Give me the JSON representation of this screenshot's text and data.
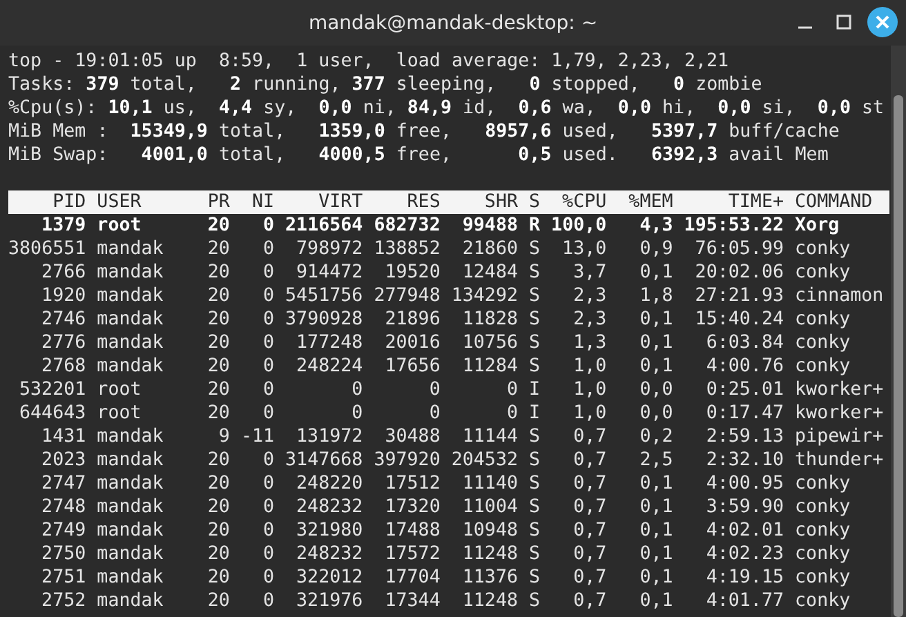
{
  "window": {
    "title": "mandak@mandak-desktop: ~"
  },
  "summary": [
    "top - 19:01:05 up  8:59,  1 user,  load average: 1,79, 2,23, 2,21",
    "Tasks: **379** total,   **2** running, **377** sleeping,   **0** stopped,   **0** zombie",
    "%Cpu(s): **10,1** us,  **4,4** sy,  **0,0** ni, **84,9** id,  **0,6** wa,  **0,0** hi,  **0,0** si,  **0,0** st",
    "MiB Mem :  **15349,9** total,   **1359,0** free,   **8957,6** used,   **5397,7** buff/cache",
    "MiB Swap:   **4001,0** total,   **4000,5** free,      **0,5** used.   **6392,3** avail Mem"
  ],
  "columns": [
    "PID",
    "USER",
    "PR",
    "NI",
    "VIRT",
    "RES",
    "SHR",
    "S",
    "%CPU",
    "%MEM",
    "TIME+",
    "COMMAND"
  ],
  "processes": [
    {
      "cells": [
        "1379",
        "root",
        "20",
        "0",
        "2116564",
        "682732",
        "99488",
        "R",
        "100,0",
        "4,3",
        "195:53.22",
        "Xorg"
      ],
      "highlighted": true
    },
    {
      "cells": [
        "3806551",
        "mandak",
        "20",
        "0",
        "798972",
        "138852",
        "21860",
        "S",
        "13,0",
        "0,9",
        "76:05.99",
        "conky"
      ],
      "highlighted": false
    },
    {
      "cells": [
        "2766",
        "mandak",
        "20",
        "0",
        "914472",
        "19520",
        "12484",
        "S",
        "3,7",
        "0,1",
        "20:02.06",
        "conky"
      ],
      "highlighted": false
    },
    {
      "cells": [
        "1920",
        "mandak",
        "20",
        "0",
        "5451756",
        "277948",
        "134292",
        "S",
        "2,3",
        "1,8",
        "27:21.93",
        "cinnamon"
      ],
      "highlighted": false
    },
    {
      "cells": [
        "2746",
        "mandak",
        "20",
        "0",
        "3790928",
        "21896",
        "11828",
        "S",
        "2,3",
        "0,1",
        "15:40.24",
        "conky"
      ],
      "highlighted": false
    },
    {
      "cells": [
        "2776",
        "mandak",
        "20",
        "0",
        "177248",
        "20016",
        "10756",
        "S",
        "1,3",
        "0,1",
        "6:03.84",
        "conky"
      ],
      "highlighted": false
    },
    {
      "cells": [
        "2768",
        "mandak",
        "20",
        "0",
        "248224",
        "17656",
        "11284",
        "S",
        "1,0",
        "0,1",
        "4:00.76",
        "conky"
      ],
      "highlighted": false
    },
    {
      "cells": [
        "532201",
        "root",
        "20",
        "0",
        "0",
        "0",
        "0",
        "I",
        "1,0",
        "0,0",
        "0:25.01",
        "kworker+"
      ],
      "highlighted": false
    },
    {
      "cells": [
        "644643",
        "root",
        "20",
        "0",
        "0",
        "0",
        "0",
        "I",
        "1,0",
        "0,0",
        "0:17.47",
        "kworker+"
      ],
      "highlighted": false
    },
    {
      "cells": [
        "1431",
        "mandak",
        "9",
        "-11",
        "131972",
        "30488",
        "11144",
        "S",
        "0,7",
        "0,2",
        "2:59.13",
        "pipewir+"
      ],
      "highlighted": false
    },
    {
      "cells": [
        "2023",
        "mandak",
        "20",
        "0",
        "3147668",
        "397920",
        "204532",
        "S",
        "0,7",
        "2,5",
        "2:32.10",
        "thunder+"
      ],
      "highlighted": false
    },
    {
      "cells": [
        "2747",
        "mandak",
        "20",
        "0",
        "248220",
        "17512",
        "11140",
        "S",
        "0,7",
        "0,1",
        "4:00.95",
        "conky"
      ],
      "highlighted": false
    },
    {
      "cells": [
        "2748",
        "mandak",
        "20",
        "0",
        "248232",
        "17320",
        "11004",
        "S",
        "0,7",
        "0,1",
        "3:59.90",
        "conky"
      ],
      "highlighted": false
    },
    {
      "cells": [
        "2749",
        "mandak",
        "20",
        "0",
        "321980",
        "17488",
        "10948",
        "S",
        "0,7",
        "0,1",
        "4:02.01",
        "conky"
      ],
      "highlighted": false
    },
    {
      "cells": [
        "2750",
        "mandak",
        "20",
        "0",
        "248232",
        "17572",
        "11248",
        "S",
        "0,7",
        "0,1",
        "4:02.23",
        "conky"
      ],
      "highlighted": false
    },
    {
      "cells": [
        "2751",
        "mandak",
        "20",
        "0",
        "322012",
        "17704",
        "11376",
        "S",
        "0,7",
        "0,1",
        "4:19.15",
        "conky"
      ],
      "highlighted": false
    },
    {
      "cells": [
        "2752",
        "mandak",
        "20",
        "0",
        "321976",
        "17344",
        "11248",
        "S",
        "0,7",
        "0,1",
        "4:01.77",
        "conky"
      ],
      "highlighted": false
    }
  ]
}
